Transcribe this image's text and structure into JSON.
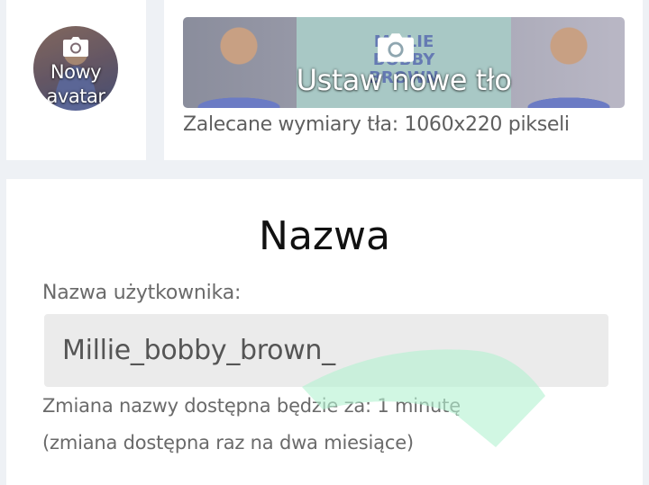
{
  "avatar": {
    "label": "Nowy avatar",
    "icon": "camera-icon"
  },
  "background": {
    "label": "Ustaw nowe tło",
    "icon": "camera-icon",
    "hint": "Zalecane wymiary tła: 1060x220 pikseli"
  },
  "name_section": {
    "title": "Nazwa",
    "username_label": "Nazwa użytkownika:",
    "username_value": "Millie_bobby_brown_",
    "availability": "Zmiana nazwy dostępna będzie za: 1 minutę",
    "frequency_note": "(zmiana dostępna raz na dwa miesiące)"
  },
  "colors": {
    "page_background": "#eef1f5",
    "card": "#ffffff",
    "input_background": "#ebebeb",
    "swipe_overlay": "#b4f2d2"
  }
}
